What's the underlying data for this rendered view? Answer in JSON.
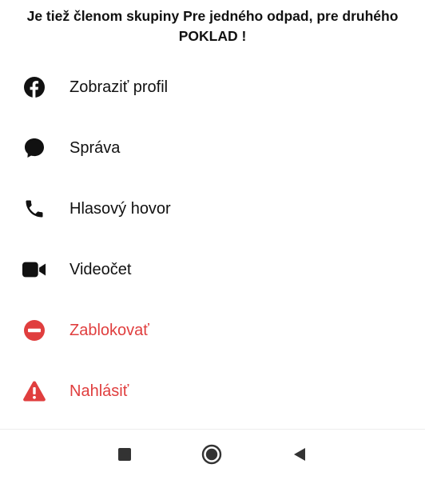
{
  "header": {
    "title": "Je tiež členom skupiny Pre jedného odpad, pre druhého POKLAD !"
  },
  "menu": {
    "items": [
      {
        "label": "Zobraziť profil",
        "icon": "facebook-icon"
      },
      {
        "label": "Správa",
        "icon": "message-bubble-icon"
      },
      {
        "label": "Hlasový hovor",
        "icon": "phone-icon"
      },
      {
        "label": "Videočet",
        "icon": "video-camera-icon"
      },
      {
        "label": "Zablokovať",
        "icon": "block-icon"
      },
      {
        "label": "Nahlásiť",
        "icon": "warning-icon"
      }
    ]
  },
  "colors": {
    "text": "#111111",
    "danger": "#e03e3e",
    "nav": "#333333"
  },
  "navbar": {
    "items": [
      "recent-apps-icon",
      "home-icon",
      "back-icon"
    ]
  }
}
